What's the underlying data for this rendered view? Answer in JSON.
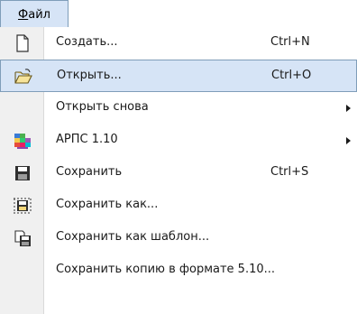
{
  "menubar": {
    "file_accel": "Ф",
    "file_rest": "айл"
  },
  "menu": {
    "items": [
      {
        "label": "Создать...",
        "shortcut": "Ctrl+N",
        "icon": "new-document-icon"
      },
      {
        "label": "Открыть...",
        "shortcut": "Ctrl+O",
        "icon": "open-folder-icon",
        "highlighted": true
      },
      {
        "label": "Открыть снова",
        "submenu": true
      },
      {
        "label": "АРПС 1.10",
        "icon": "colorful-grid-icon",
        "submenu": true
      },
      {
        "label": "Сохранить",
        "shortcut": "Ctrl+S",
        "icon": "floppy-disk-icon"
      },
      {
        "label": "Сохранить как...",
        "icon": "save-as-icon"
      },
      {
        "label": "Сохранить как шаблон...",
        "icon": "save-template-icon"
      },
      {
        "label": "Сохранить копию в формате 5.10..."
      }
    ]
  },
  "colors": {
    "highlight": "#d6e4f6",
    "highlight_border": "#7f9db9",
    "gutter": "#f0f0f0"
  }
}
